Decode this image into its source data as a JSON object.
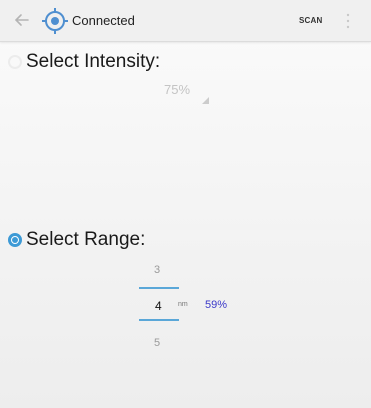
{
  "toolbar": {
    "title": "Connected",
    "scan_label": "SCAN",
    "icons": [
      "back-arrow-icon",
      "crosshair-logo-icon",
      "overflow-menu-icon"
    ]
  },
  "intensity": {
    "label": "Select Intensity:",
    "selected": false,
    "value": "75%"
  },
  "range": {
    "label": "Select Range:",
    "selected": true,
    "picker": {
      "previous": "3",
      "current": "4",
      "next": "5",
      "unit": "nm"
    },
    "percent": "59%"
  },
  "colors": {
    "accent": "#3d9ad6",
    "percent": "#3a38c8"
  }
}
